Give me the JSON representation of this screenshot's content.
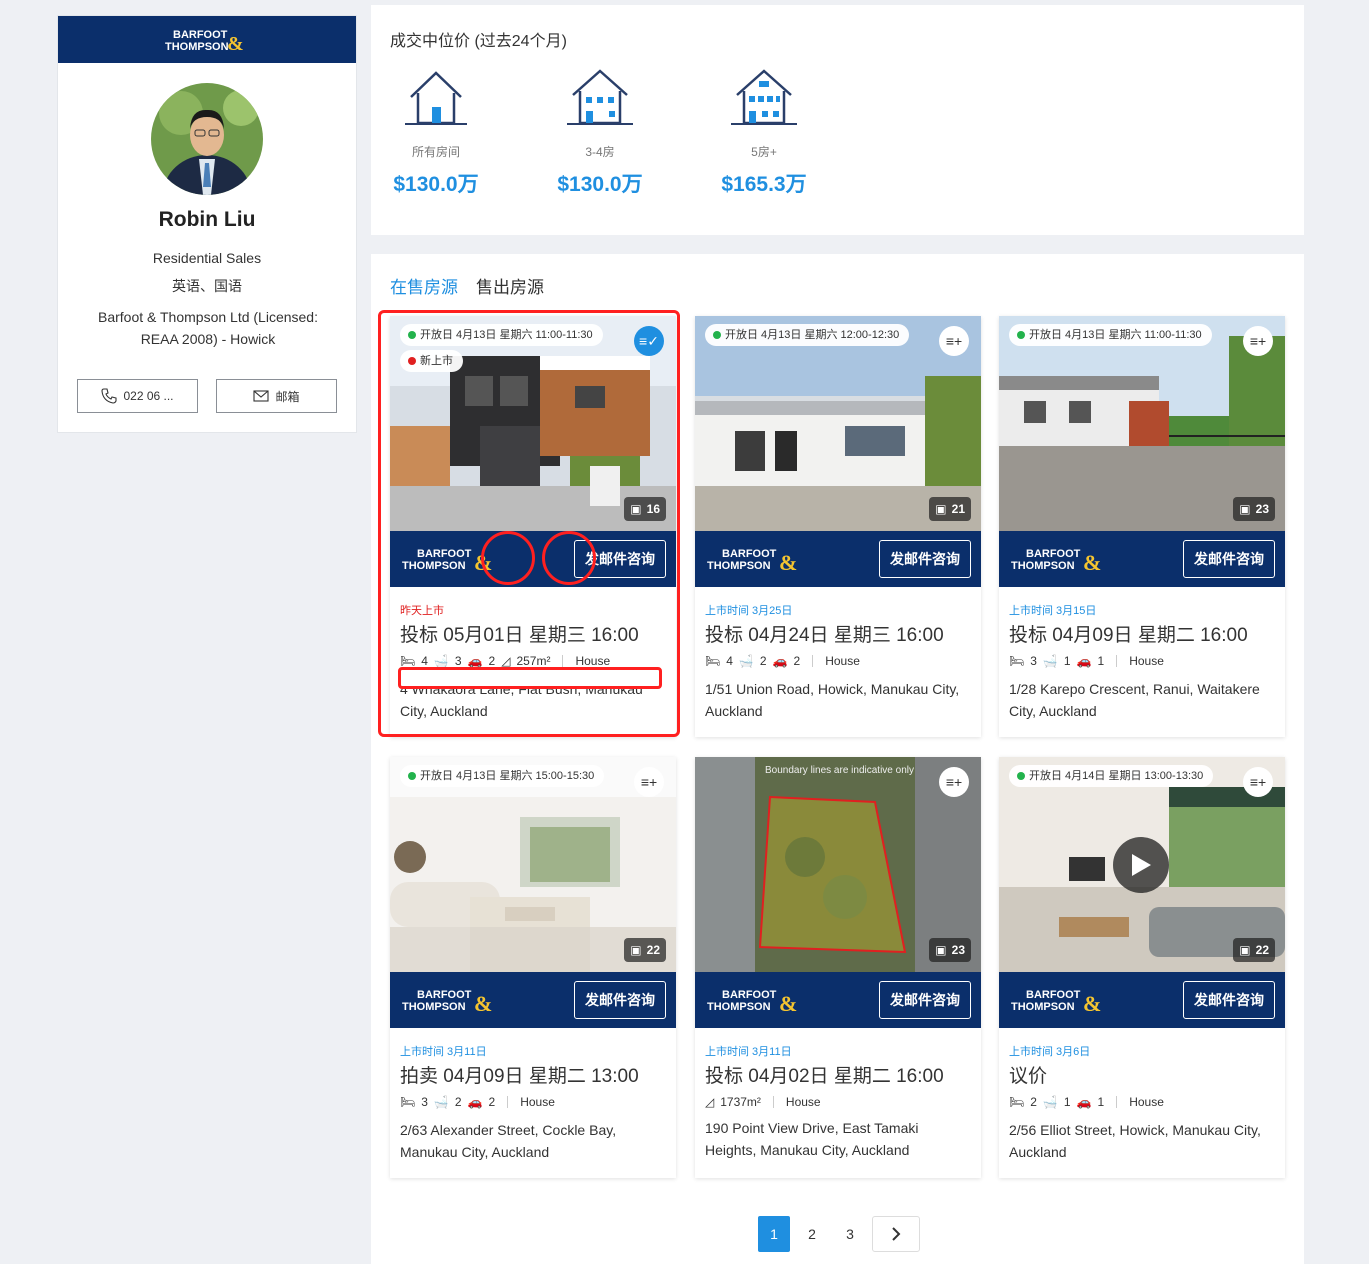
{
  "agent": {
    "brand_line1": "BARFOOT",
    "brand_line2": "THOMPSON",
    "name": "Robin Liu",
    "role": "Residential Sales",
    "languages": "英语、国语",
    "company": "Barfoot & Thompson Ltd (Licensed: REAA 2008) - Howick",
    "phone_label": "022 06 ...",
    "email_label": "邮箱"
  },
  "median": {
    "title": "成交中位价 (过去24个月)",
    "stats": [
      {
        "label": "所有房间",
        "value": "$130.0万",
        "icon": "house-icon"
      },
      {
        "label": "3-4房",
        "value": "$130.0万",
        "icon": "house-medium-icon"
      },
      {
        "label": "5房+",
        "value": "$165.3万",
        "icon": "house-large-icon"
      }
    ]
  },
  "tabs": [
    {
      "label": "在售房源",
      "active": true
    },
    {
      "label": "售出房源",
      "active": false
    }
  ],
  "brand": {
    "line1": "BARFOOT",
    "line2": "THOMPSON",
    "enquiry": "发邮件咨询"
  },
  "listings": [
    {
      "badge": "开放日 4月13日 星期六 11:00-11:30",
      "new_badge": "新上市",
      "photo_count": "16",
      "status": "昨天上市",
      "sale": "投标 05月01日 星期三 16:00",
      "beds": "4",
      "baths": "3",
      "garage": "2",
      "area": "257m²",
      "type": "House",
      "address": "4 Whakaora Lane, Flat Bush, Manukau City, Auckland"
    },
    {
      "badge": "开放日 4月13日 星期六 12:00-12:30",
      "photo_count": "21",
      "status": "上市时间 3月25日",
      "sale": "投标 04月24日 星期三 16:00",
      "beds": "4",
      "baths": "2",
      "garage": "2",
      "type": "House",
      "address": "1/51 Union Road, Howick, Manukau City, Auckland"
    },
    {
      "badge": "开放日 4月13日 星期六 11:00-11:30",
      "photo_count": "23",
      "status": "上市时间 3月15日",
      "sale": "投标 04月09日 星期二 16:00",
      "beds": "3",
      "baths": "1",
      "garage": "1",
      "type": "House",
      "address": "1/28 Karepo Crescent, Ranui, Waitakere City, Auckland"
    },
    {
      "badge": "开放日 4月13日 星期六 15:00-15:30",
      "photo_count": "22",
      "status": "上市时间 3月11日",
      "sale": "拍卖 04月09日 星期二 13:00",
      "beds": "3",
      "baths": "2",
      "garage": "2",
      "type": "House",
      "address": "2/63 Alexander Street, Cockle Bay, Manukau City, Auckland"
    },
    {
      "photo_caption": "Boundary lines are indicative only",
      "photo_count": "23",
      "status": "上市时间 3月11日",
      "sale": "投标 04月02日 星期二 16:00",
      "area": "1737m²",
      "type": "House",
      "address": "190 Point View Drive, East Tamaki Heights, Manukau City, Auckland"
    },
    {
      "badge": "开放日 4月14日 星期日 13:00-13:30",
      "photo_count": "22",
      "status": "上市时间 3月6日",
      "sale": "议价",
      "beds": "2",
      "baths": "1",
      "garage": "1",
      "type": "House",
      "address": "2/56 Elliot Street, Howick, Manukau City, Auckland"
    }
  ],
  "pagination": {
    "pages": [
      "1",
      "2",
      "3"
    ],
    "current": "1"
  },
  "colors": {
    "brand_navy": "#0b2f6b",
    "accent_blue": "#1f8fe0",
    "annotation_red": "#ff2020",
    "new_red": "#e02020"
  }
}
